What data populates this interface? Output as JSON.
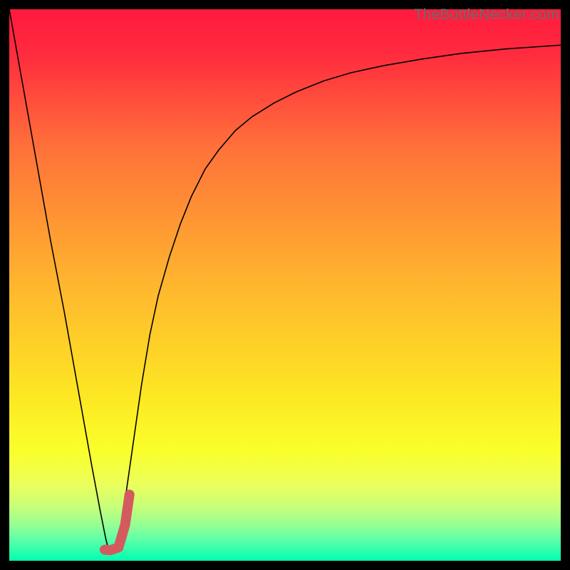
{
  "watermark": "TheBottleNecker.com",
  "chart_data": {
    "type": "line",
    "title": "",
    "xlabel": "",
    "ylabel": "",
    "xlim": [
      0,
      100
    ],
    "ylim": [
      0,
      100
    ],
    "background_gradient": {
      "stops": [
        {
          "offset": 0.0,
          "color": "#ff1a3e"
        },
        {
          "offset": 0.08,
          "color": "#ff2b3e"
        },
        {
          "offset": 0.25,
          "color": "#ff713a"
        },
        {
          "offset": 0.5,
          "color": "#ffb62e"
        },
        {
          "offset": 0.7,
          "color": "#fde723"
        },
        {
          "offset": 0.8,
          "color": "#faff2a"
        },
        {
          "offset": 0.86,
          "color": "#ecff5a"
        },
        {
          "offset": 0.9,
          "color": "#c9ff78"
        },
        {
          "offset": 0.93,
          "color": "#9fff8f"
        },
        {
          "offset": 0.96,
          "color": "#62ffa6"
        },
        {
          "offset": 1.0,
          "color": "#00ffb0"
        }
      ]
    },
    "series": [
      {
        "name": "curve",
        "stroke": "#000000",
        "stroke_width": 1.6,
        "x": [
          0.0,
          2.5,
          5.0,
          7.5,
          10.0,
          12.5,
          15.0,
          16.5,
          17.5,
          18.0,
          19.0,
          20.0,
          21.0,
          22.0,
          23.0,
          24.0,
          25.5,
          27.0,
          29.0,
          31.0,
          33.0,
          35.5,
          38.0,
          41.0,
          44.0,
          48.0,
          52.0,
          57.0,
          62.0,
          68.0,
          75.0,
          82.0,
          90.0,
          100.0
        ],
        "y": [
          100.0,
          86.0,
          72.0,
          58.0,
          45.0,
          31.0,
          17.0,
          9.0,
          4.0,
          2.0,
          2.5,
          5.0,
          11.0,
          18.0,
          25.0,
          32.0,
          41.0,
          48.0,
          55.0,
          61.0,
          66.0,
          71.0,
          74.5,
          78.0,
          80.5,
          83.0,
          85.0,
          87.0,
          88.5,
          89.8,
          91.0,
          92.0,
          92.8,
          93.5
        ]
      },
      {
        "name": "marker",
        "stroke": "#d35b5f",
        "stroke_width": 14,
        "linecap": "round",
        "x": [
          17.3,
          18.3,
          19.8,
          21.0,
          21.8
        ],
        "y": [
          2.0,
          1.9,
          2.4,
          6.5,
          12.0
        ]
      }
    ]
  }
}
